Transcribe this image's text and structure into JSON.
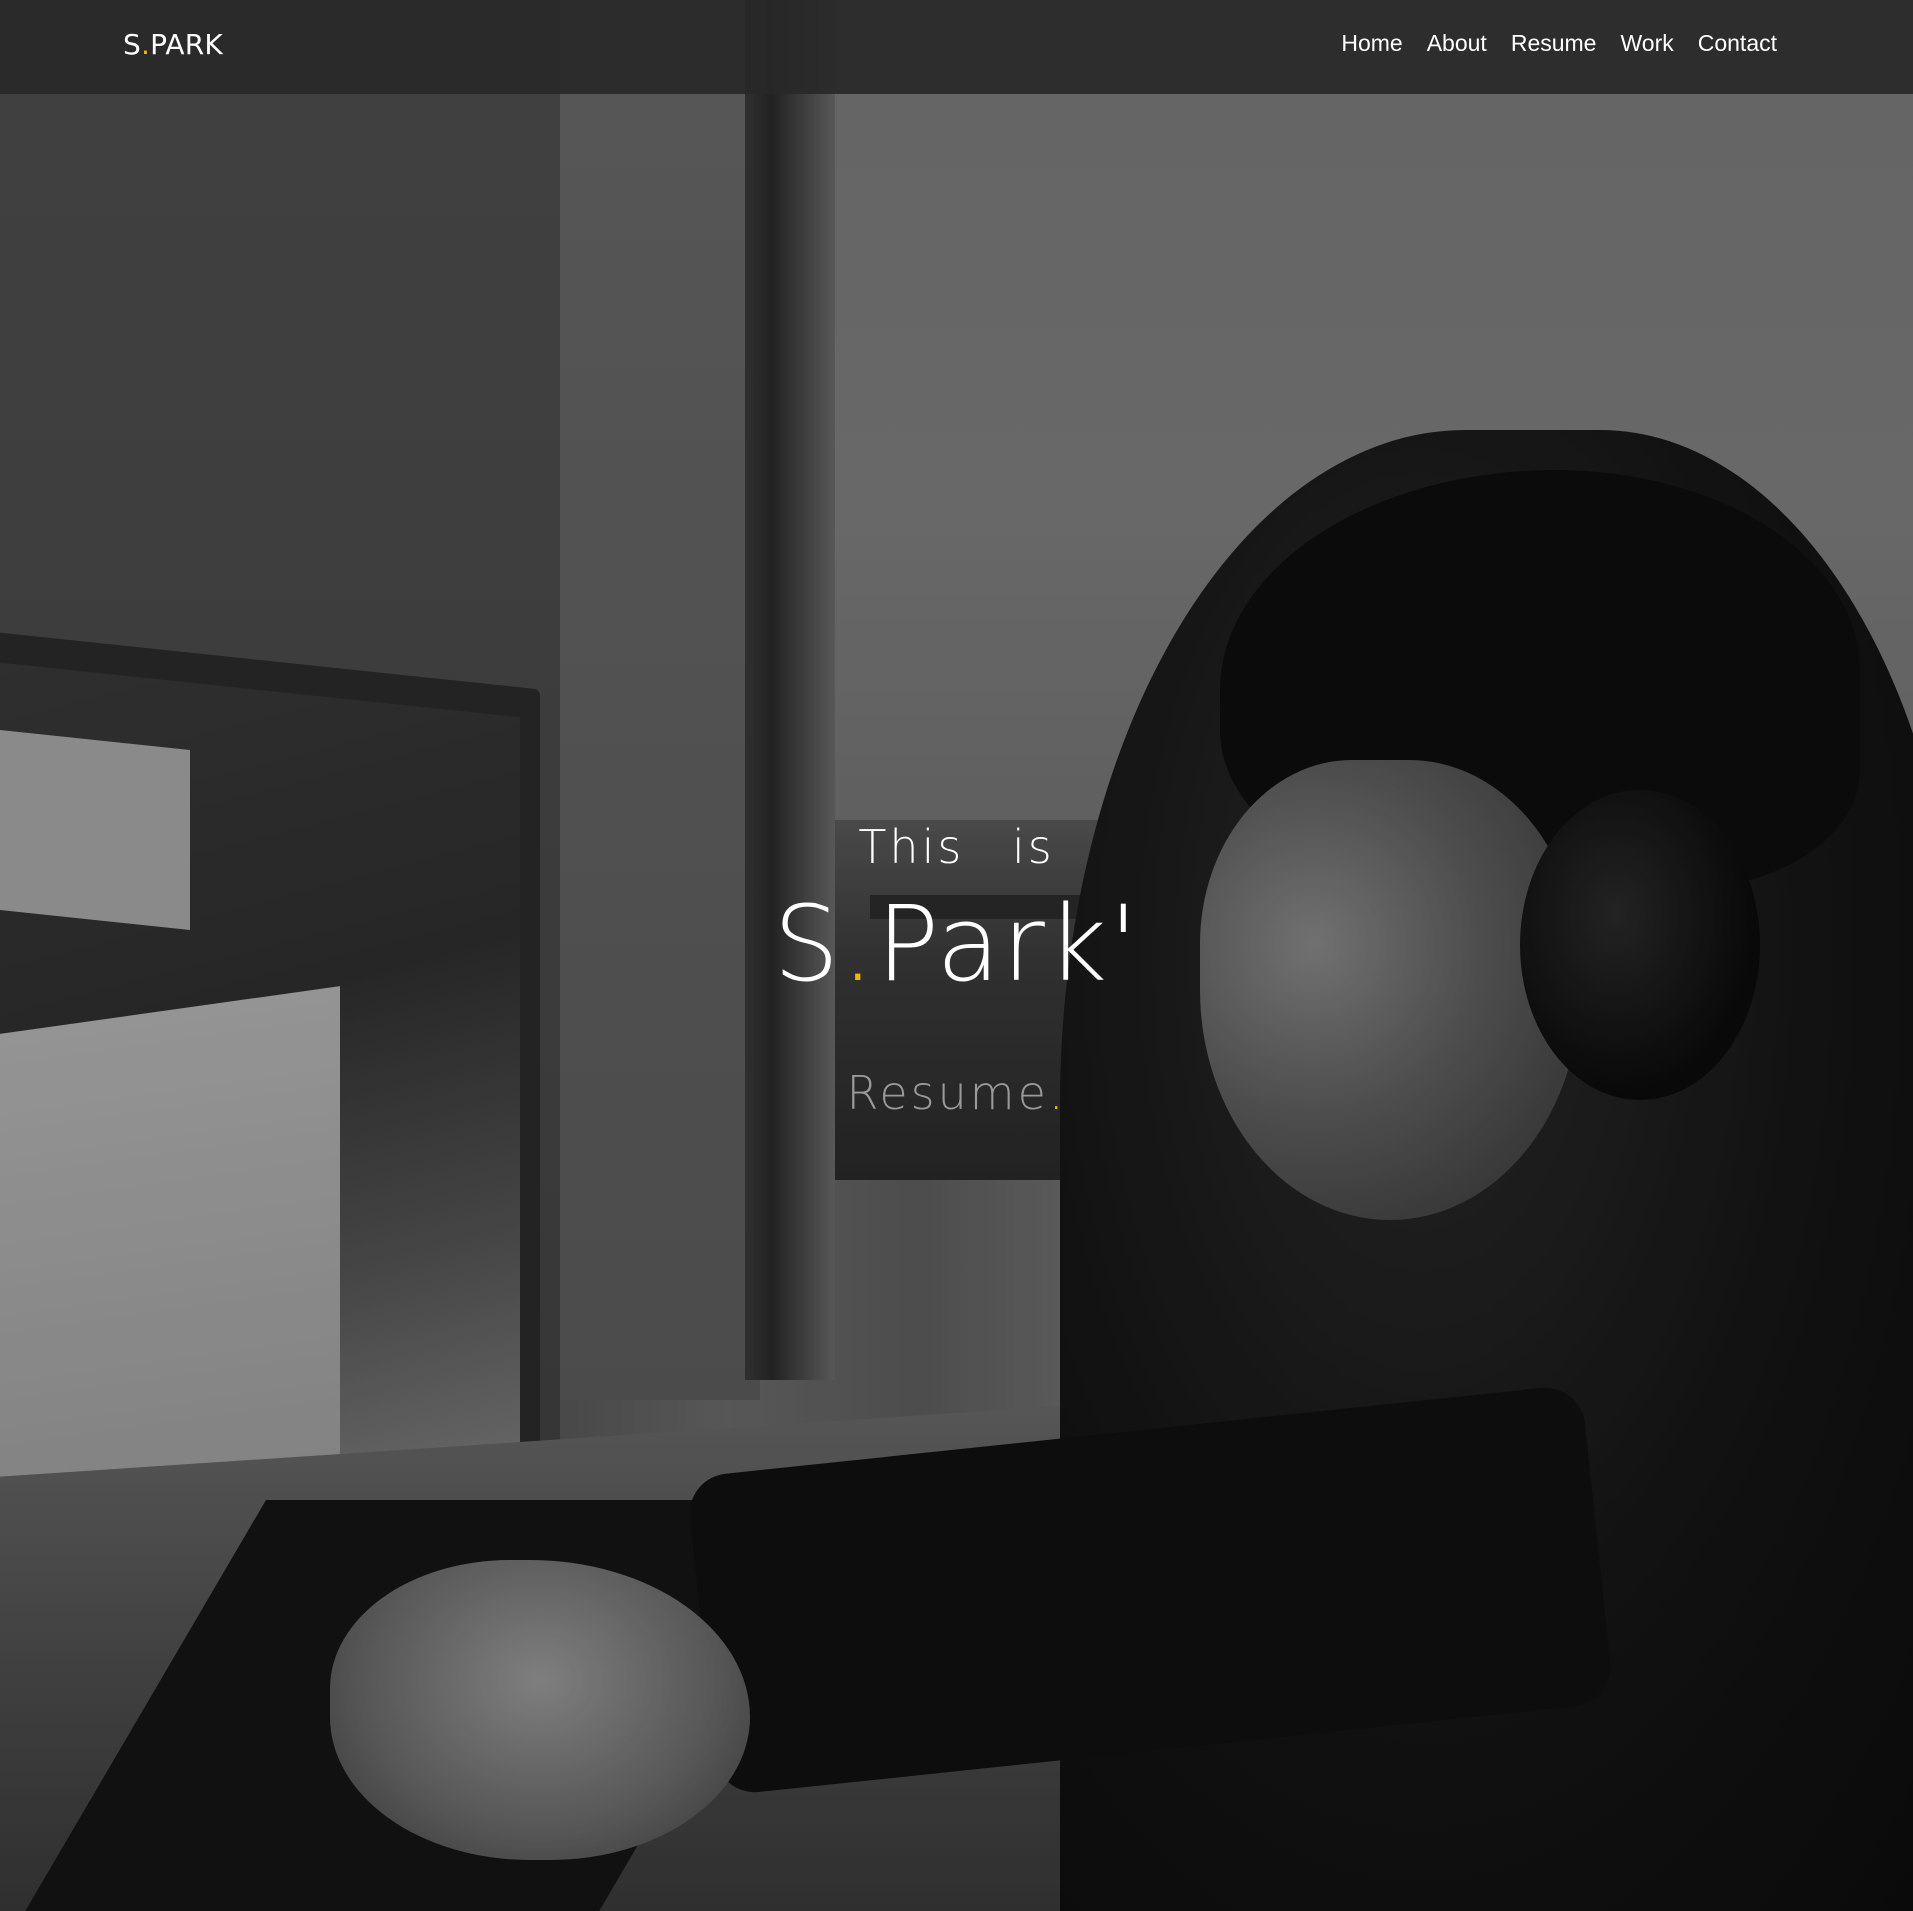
{
  "brand": {
    "prefix": "S",
    "dot": ".",
    "suffix": "PARK"
  },
  "nav": {
    "items": [
      {
        "label": "Home"
      },
      {
        "label": "About"
      },
      {
        "label": "Resume"
      },
      {
        "label": "Work"
      },
      {
        "label": "Contact"
      }
    ]
  },
  "hero": {
    "intro_word1": "This",
    "intro_word2": "is",
    "name_prefix": "S",
    "name_dot": ".",
    "name_suffix": "Park'",
    "subtitle": "Resume",
    "subtitle_dot": "."
  },
  "colors": {
    "accent": "#f4b400",
    "navbar": "#2a2a2a",
    "text": "#ffffff",
    "muted": "#9a9a9a"
  },
  "background": {
    "image": "grayscale-photo-of-person-with-headphones-at-computer"
  }
}
